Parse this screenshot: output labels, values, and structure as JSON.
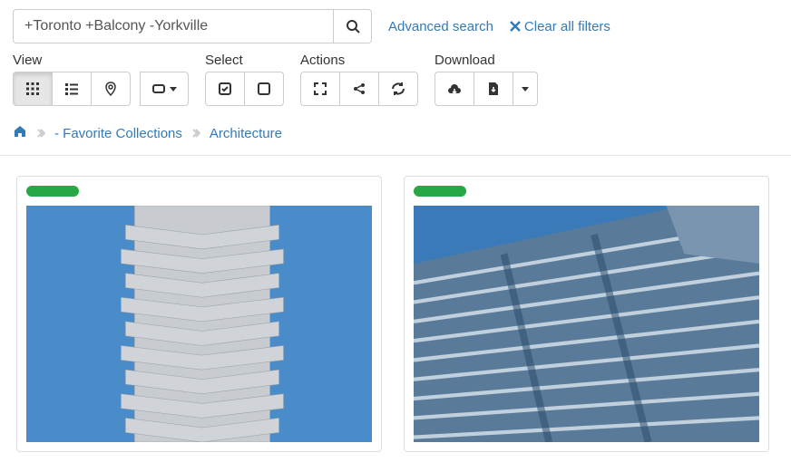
{
  "search": {
    "value": "+Toronto +Balcony -Yorkville",
    "advanced_label": "Advanced search",
    "clear_label": "Clear all filters"
  },
  "toolbar": {
    "view_label": "View",
    "select_label": "Select",
    "actions_label": "Actions",
    "download_label": "Download"
  },
  "breadcrumb": {
    "favorites": "- Favorite Collections",
    "current": "Architecture"
  },
  "results": [
    {
      "status_color": "#28a745"
    },
    {
      "status_color": "#28a745"
    }
  ]
}
